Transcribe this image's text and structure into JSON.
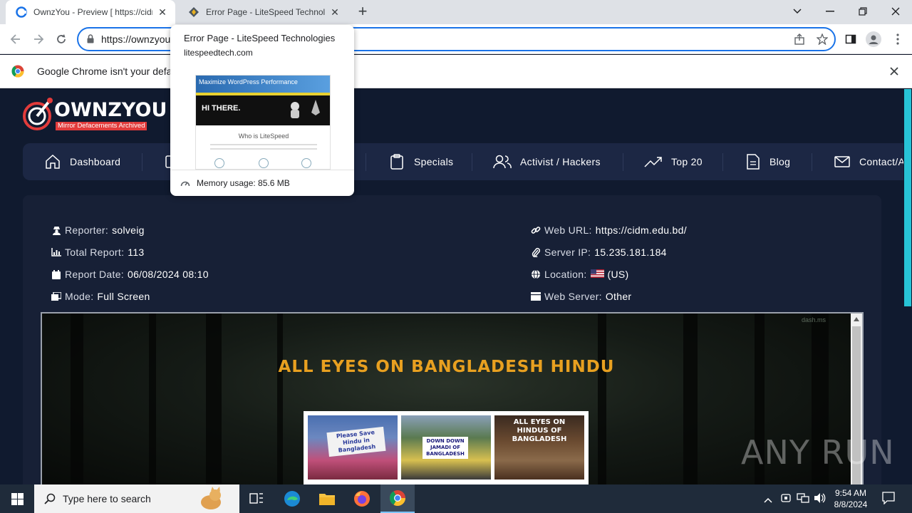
{
  "browser": {
    "tabs": [
      {
        "title": "OwnzYou - Preview [ https://cidm.edu.bd/ ]",
        "active": true
      },
      {
        "title": "Error Page - LiteSpeed Technologies",
        "active": false
      }
    ],
    "new_tab_label": "+",
    "address": "https://ownzyou",
    "infobar_message": "Google Chrome isn't your defau"
  },
  "hover_card": {
    "title": "Error Page - LiteSpeed Technologies",
    "domain": "litespeedtech.com",
    "memory": "Memory usage: 85.6 MB",
    "thumbnail": {
      "banner": "Maximize WordPress Performance",
      "greeting": "HI THERE.",
      "heading": "Who is LiteSpeed"
    }
  },
  "site": {
    "logo_text": "OWNZYOU",
    "logo_tagline": "Mirror Defacements Archived",
    "nav": [
      {
        "label": "Dashboard",
        "icon": "home-icon"
      },
      {
        "label": "",
        "icon": "archive-icon"
      },
      {
        "label": "Specials",
        "icon": "clipboard-icon"
      },
      {
        "label": "Activist / Hackers",
        "icon": "users-icon"
      },
      {
        "label": "Top 20",
        "icon": "trending-icon"
      },
      {
        "label": "Blog",
        "icon": "document-icon"
      },
      {
        "label": "Contact/A",
        "icon": "mail-icon"
      }
    ]
  },
  "report": {
    "reporter_label": "Reporter:",
    "reporter": "solveig",
    "total_label": "Total Report:",
    "total": "113",
    "date_label": "Report Date:",
    "date": "06/08/2024 08:10",
    "mode_label": "Mode:",
    "mode": "Full Screen",
    "url_label": "Web URL:",
    "url": "https://cidm.edu.bd/",
    "ip_label": "Server IP:",
    "ip": "15.235.181.184",
    "location_label": "Location:",
    "location": "(US)",
    "server_label": "Web Server:",
    "server": "Other"
  },
  "mirror": {
    "headline": "ALL EYES ON BANGLADESH HINDU",
    "small_mark": "dash.ms",
    "images": [
      {
        "caption": "Please Save Hindu in Bangladesh"
      },
      {
        "caption": "DOWN DOWN JAMADI OF BANGLADESH"
      },
      {
        "caption": "ALL EYES ON HINDUS OF BANGLADESH"
      }
    ]
  },
  "watermark": "ANY RUN",
  "taskbar": {
    "search_placeholder": "Type here to search",
    "time": "9:54 AM",
    "date": "8/8/2024"
  },
  "colors": {
    "accent": "#1a73e8",
    "page_bg": "#101a2f",
    "nav_bg": "#1c2744",
    "headline": "#e8a020",
    "scroll_accent": "#27c3d6"
  }
}
